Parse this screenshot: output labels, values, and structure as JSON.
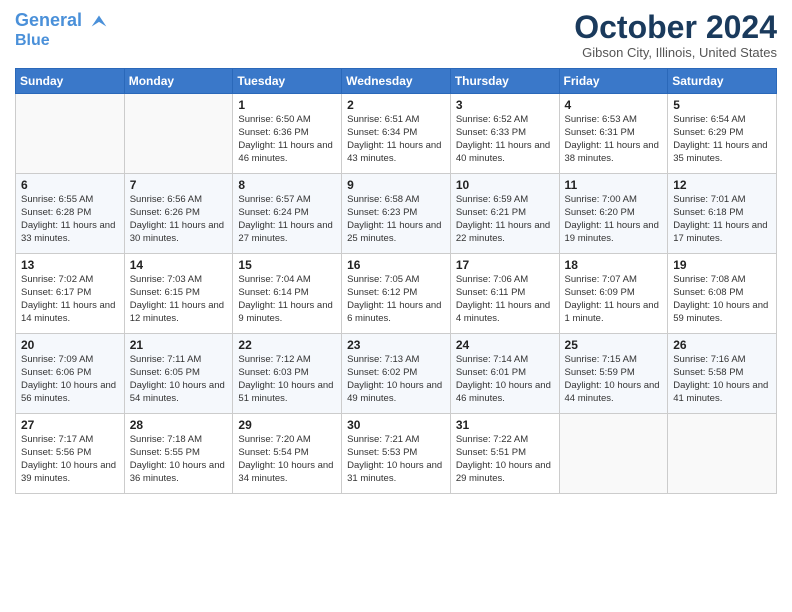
{
  "logo": {
    "line1": "General",
    "line2": "Blue"
  },
  "header": {
    "month": "October 2024",
    "location": "Gibson City, Illinois, United States"
  },
  "weekdays": [
    "Sunday",
    "Monday",
    "Tuesday",
    "Wednesday",
    "Thursday",
    "Friday",
    "Saturday"
  ],
  "weeks": [
    [
      {
        "day": "",
        "content": ""
      },
      {
        "day": "",
        "content": ""
      },
      {
        "day": "1",
        "content": "Sunrise: 6:50 AM\nSunset: 6:36 PM\nDaylight: 11 hours and 46 minutes."
      },
      {
        "day": "2",
        "content": "Sunrise: 6:51 AM\nSunset: 6:34 PM\nDaylight: 11 hours and 43 minutes."
      },
      {
        "day": "3",
        "content": "Sunrise: 6:52 AM\nSunset: 6:33 PM\nDaylight: 11 hours and 40 minutes."
      },
      {
        "day": "4",
        "content": "Sunrise: 6:53 AM\nSunset: 6:31 PM\nDaylight: 11 hours and 38 minutes."
      },
      {
        "day": "5",
        "content": "Sunrise: 6:54 AM\nSunset: 6:29 PM\nDaylight: 11 hours and 35 minutes."
      }
    ],
    [
      {
        "day": "6",
        "content": "Sunrise: 6:55 AM\nSunset: 6:28 PM\nDaylight: 11 hours and 33 minutes."
      },
      {
        "day": "7",
        "content": "Sunrise: 6:56 AM\nSunset: 6:26 PM\nDaylight: 11 hours and 30 minutes."
      },
      {
        "day": "8",
        "content": "Sunrise: 6:57 AM\nSunset: 6:24 PM\nDaylight: 11 hours and 27 minutes."
      },
      {
        "day": "9",
        "content": "Sunrise: 6:58 AM\nSunset: 6:23 PM\nDaylight: 11 hours and 25 minutes."
      },
      {
        "day": "10",
        "content": "Sunrise: 6:59 AM\nSunset: 6:21 PM\nDaylight: 11 hours and 22 minutes."
      },
      {
        "day": "11",
        "content": "Sunrise: 7:00 AM\nSunset: 6:20 PM\nDaylight: 11 hours and 19 minutes."
      },
      {
        "day": "12",
        "content": "Sunrise: 7:01 AM\nSunset: 6:18 PM\nDaylight: 11 hours and 17 minutes."
      }
    ],
    [
      {
        "day": "13",
        "content": "Sunrise: 7:02 AM\nSunset: 6:17 PM\nDaylight: 11 hours and 14 minutes."
      },
      {
        "day": "14",
        "content": "Sunrise: 7:03 AM\nSunset: 6:15 PM\nDaylight: 11 hours and 12 minutes."
      },
      {
        "day": "15",
        "content": "Sunrise: 7:04 AM\nSunset: 6:14 PM\nDaylight: 11 hours and 9 minutes."
      },
      {
        "day": "16",
        "content": "Sunrise: 7:05 AM\nSunset: 6:12 PM\nDaylight: 11 hours and 6 minutes."
      },
      {
        "day": "17",
        "content": "Sunrise: 7:06 AM\nSunset: 6:11 PM\nDaylight: 11 hours and 4 minutes."
      },
      {
        "day": "18",
        "content": "Sunrise: 7:07 AM\nSunset: 6:09 PM\nDaylight: 11 hours and 1 minute."
      },
      {
        "day": "19",
        "content": "Sunrise: 7:08 AM\nSunset: 6:08 PM\nDaylight: 10 hours and 59 minutes."
      }
    ],
    [
      {
        "day": "20",
        "content": "Sunrise: 7:09 AM\nSunset: 6:06 PM\nDaylight: 10 hours and 56 minutes."
      },
      {
        "day": "21",
        "content": "Sunrise: 7:11 AM\nSunset: 6:05 PM\nDaylight: 10 hours and 54 minutes."
      },
      {
        "day": "22",
        "content": "Sunrise: 7:12 AM\nSunset: 6:03 PM\nDaylight: 10 hours and 51 minutes."
      },
      {
        "day": "23",
        "content": "Sunrise: 7:13 AM\nSunset: 6:02 PM\nDaylight: 10 hours and 49 minutes."
      },
      {
        "day": "24",
        "content": "Sunrise: 7:14 AM\nSunset: 6:01 PM\nDaylight: 10 hours and 46 minutes."
      },
      {
        "day": "25",
        "content": "Sunrise: 7:15 AM\nSunset: 5:59 PM\nDaylight: 10 hours and 44 minutes."
      },
      {
        "day": "26",
        "content": "Sunrise: 7:16 AM\nSunset: 5:58 PM\nDaylight: 10 hours and 41 minutes."
      }
    ],
    [
      {
        "day": "27",
        "content": "Sunrise: 7:17 AM\nSunset: 5:56 PM\nDaylight: 10 hours and 39 minutes."
      },
      {
        "day": "28",
        "content": "Sunrise: 7:18 AM\nSunset: 5:55 PM\nDaylight: 10 hours and 36 minutes."
      },
      {
        "day": "29",
        "content": "Sunrise: 7:20 AM\nSunset: 5:54 PM\nDaylight: 10 hours and 34 minutes."
      },
      {
        "day": "30",
        "content": "Sunrise: 7:21 AM\nSunset: 5:53 PM\nDaylight: 10 hours and 31 minutes."
      },
      {
        "day": "31",
        "content": "Sunrise: 7:22 AM\nSunset: 5:51 PM\nDaylight: 10 hours and 29 minutes."
      },
      {
        "day": "",
        "content": ""
      },
      {
        "day": "",
        "content": ""
      }
    ]
  ]
}
